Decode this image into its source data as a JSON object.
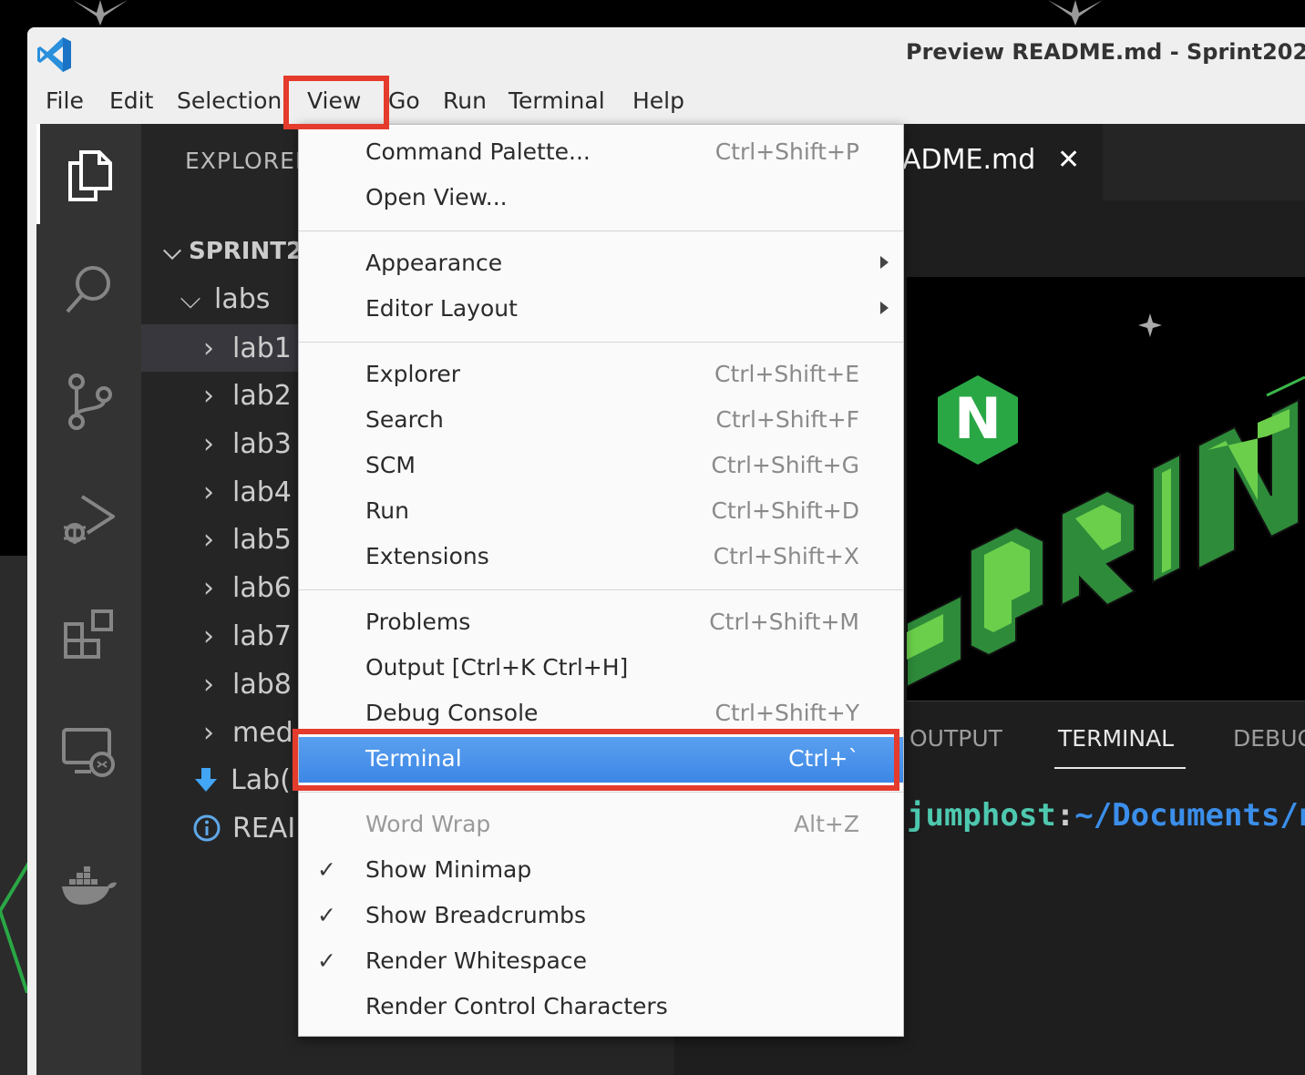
{
  "window": {
    "title": "Preview README.md - Sprint202"
  },
  "menubar": [
    "File",
    "Edit",
    "Selection",
    "View",
    "Go",
    "Run",
    "Terminal",
    "Help"
  ],
  "activity_bar": [
    "explorer-icon",
    "search-icon",
    "source-control-icon",
    "run-debug-icon",
    "extensions-icon",
    "remote-explorer-icon",
    "docker-icon"
  ],
  "explorer": {
    "title": "EXPLORER",
    "root": "SPRINT2",
    "items": [
      {
        "label": "labs",
        "chevron": "v"
      },
      {
        "label": "lab1",
        "chevron": ">"
      },
      {
        "label": "lab2",
        "chevron": ">"
      },
      {
        "label": "lab3",
        "chevron": ">"
      },
      {
        "label": "lab4",
        "chevron": ">"
      },
      {
        "label": "lab5",
        "chevron": ">"
      },
      {
        "label": "lab6",
        "chevron": ">"
      },
      {
        "label": "lab7",
        "chevron": ">"
      },
      {
        "label": "lab8",
        "chevron": ">"
      },
      {
        "label": "med",
        "chevron": ">"
      },
      {
        "label": "Lab(",
        "icon": "download-arrow-icon"
      },
      {
        "label": "REAI",
        "icon": "info-icon"
      }
    ]
  },
  "editor": {
    "tab_label": "ADME.md",
    "tab_close": "✕",
    "preview_logo": "N"
  },
  "panel": {
    "tabs": [
      "OUTPUT",
      "TERMINAL",
      "DEBUG"
    ],
    "active_tab": "TERMINAL",
    "terminal_host": "jumphost",
    "terminal_sep": ":",
    "terminal_path": "~/Documents/ng"
  },
  "view_menu": {
    "items": [
      {
        "label": "Command Palette...",
        "shortcut": "Ctrl+Shift+P"
      },
      {
        "label": "Open View...",
        "shortcut": ""
      },
      {
        "label": "Appearance",
        "submenu": true
      },
      {
        "label": "Editor Layout",
        "submenu": true
      },
      {
        "label": "Explorer",
        "shortcut": "Ctrl+Shift+E"
      },
      {
        "label": "Search",
        "shortcut": "Ctrl+Shift+F"
      },
      {
        "label": "SCM",
        "shortcut": "Ctrl+Shift+G"
      },
      {
        "label": "Run",
        "shortcut": "Ctrl+Shift+D"
      },
      {
        "label": "Extensions",
        "shortcut": "Ctrl+Shift+X"
      },
      {
        "label": "Problems",
        "shortcut": "Ctrl+Shift+M"
      },
      {
        "label": "Output [Ctrl+K Ctrl+H]",
        "shortcut": ""
      },
      {
        "label": "Debug Console",
        "shortcut": "Ctrl+Shift+Y"
      },
      {
        "label": "Terminal",
        "shortcut": "Ctrl+`",
        "highlighted": true
      },
      {
        "label": "Word Wrap",
        "shortcut": "Alt+Z",
        "disabled": true
      },
      {
        "label": "Show Minimap",
        "checked": true
      },
      {
        "label": "Show Breadcrumbs",
        "checked": true
      },
      {
        "label": "Render Whitespace",
        "checked": true
      },
      {
        "label": "Render Control Characters"
      }
    ],
    "check_glyph": "✓"
  },
  "colors": {
    "annotation": "#e53b2c",
    "highlight": "#3c86e6",
    "terminal_host": "#4ec9b0",
    "terminal_path": "#3b8eea",
    "nginx_green": "#2aa745"
  }
}
